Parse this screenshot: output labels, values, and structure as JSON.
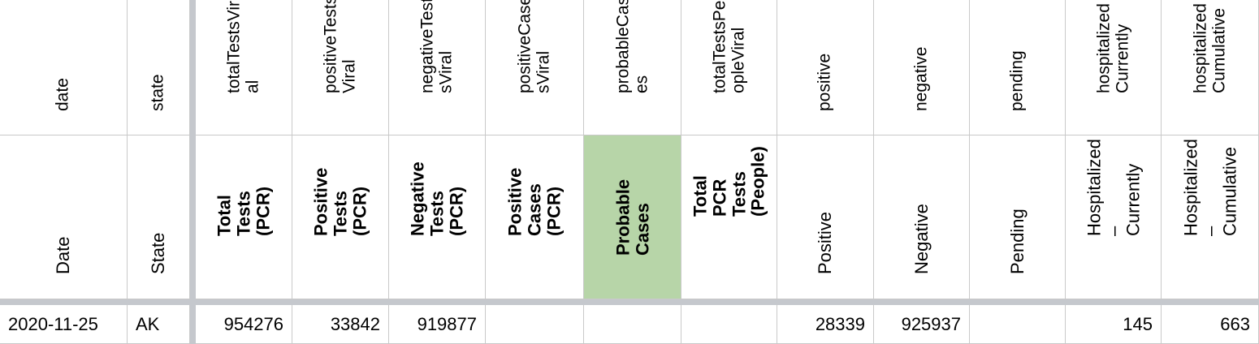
{
  "columns": [
    {
      "key": "date",
      "field": "date",
      "label": "Date"
    },
    {
      "key": "state",
      "field": "state",
      "label": "State"
    },
    {
      "key": "totalTestsViral",
      "field": "totalTestsVir\nal",
      "label": "Total Tests\n(PCR)"
    },
    {
      "key": "positiveTestsViral",
      "field": "positiveTests\nViral",
      "label": "Positive Tests\n(PCR)"
    },
    {
      "key": "negativeTestsViral",
      "field": "negativeTest\nsViral",
      "label": "Negative Tests\n(PCR)"
    },
    {
      "key": "positiveCasesViral",
      "field": "positiveCase\nsViral",
      "label": "Positive Cases\n(PCR)"
    },
    {
      "key": "probableCases",
      "field": "probableCas\nes",
      "label": "Probable Cases"
    },
    {
      "key": "totalTestsPeopleViral",
      "field": "totalTestsPe\nopleViral",
      "label": "Total PCR\nTests (People)"
    },
    {
      "key": "positive",
      "field": "positive",
      "label": "Positive"
    },
    {
      "key": "negative",
      "field": "negative",
      "label": "Negative"
    },
    {
      "key": "pending",
      "field": "pending",
      "label": "Pending"
    },
    {
      "key": "hospitalizedCurrently",
      "field": "hospitalized\nCurrently",
      "label": "Hospitalized –\nCurrently"
    },
    {
      "key": "hospitalizedCumulative",
      "field": "hospitalized\nCumulative",
      "label": "Hospitalized –\nCumulative"
    }
  ],
  "row": {
    "date": "2020-11-25",
    "state": "AK",
    "totalTestsViral": "954276",
    "positiveTestsViral": "33842",
    "negativeTestsViral": "919877",
    "positiveCasesViral": "",
    "probableCases": "",
    "totalTestsPeopleViral": "",
    "positive": "28339",
    "negative": "925937",
    "pending": "",
    "hospitalizedCurrently": "145",
    "hospitalizedCumulative": "663"
  },
  "colors": {
    "highlight": "#b7d5a8",
    "frozen_divider": "#c5c8cd",
    "gridline": "#c9c9c9"
  }
}
